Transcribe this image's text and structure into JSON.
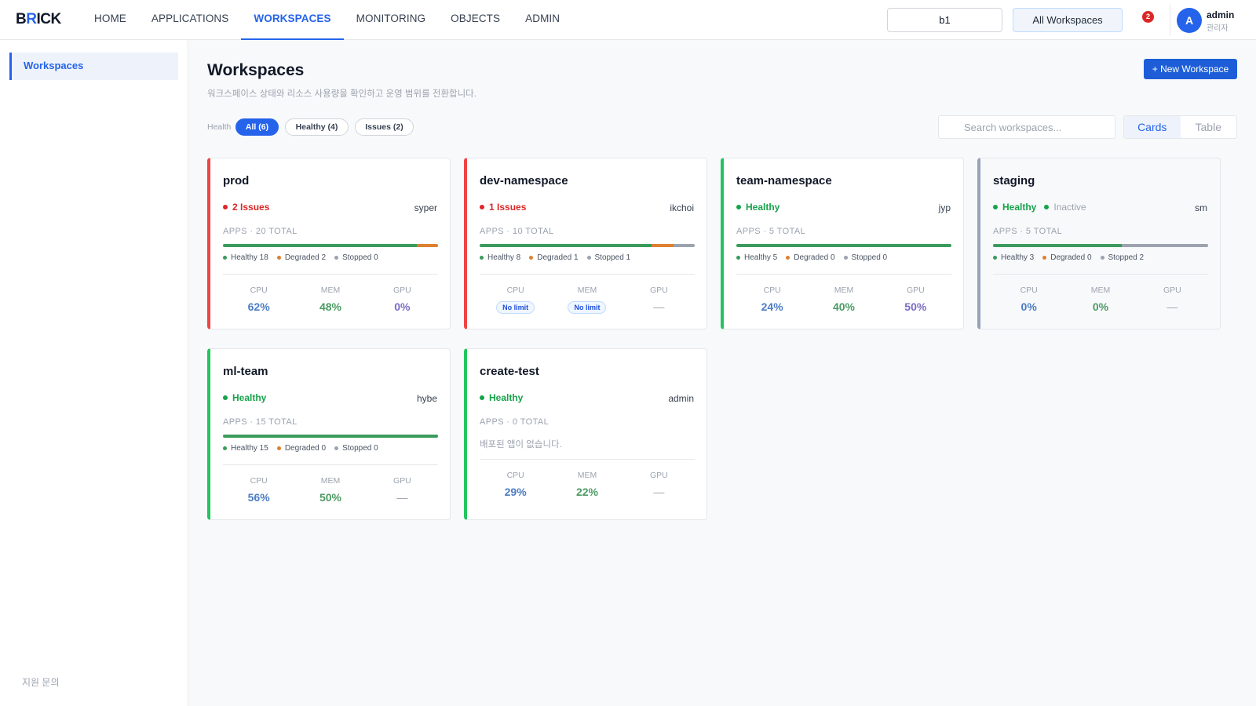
{
  "app": {
    "logo_b": "B",
    "logo_r": "R",
    "logo_rest": "ICK"
  },
  "nav": {
    "items": [
      "HOME",
      "APPLICATIONS",
      "WORKSPACES",
      "MONITORING",
      "OBJECTS",
      "ADMIN"
    ],
    "active": "WORKSPACES"
  },
  "header": {
    "namespace_value": "b1",
    "workspace_scope": "All Workspaces",
    "notification_count": "2",
    "user": {
      "initial": "A",
      "name": "admin",
      "role": "관리자"
    }
  },
  "sidebar": {
    "items": [
      {
        "label": "Workspaces"
      }
    ],
    "support_label": "지원 문의"
  },
  "page": {
    "title": "Workspaces",
    "subtitle": "워크스페이스 상태와 리소스 사용량을 확인하고 운영 범위를 전환합니다.",
    "new_button": "+ New Workspace",
    "filter_label": "Health",
    "filters": [
      "All (6)",
      "Healthy (4)",
      "Issues (2)"
    ],
    "active_filter": "All (6)",
    "search_placeholder": "Search workspaces...",
    "view_options": [
      "Cards",
      "Table"
    ],
    "active_view": "Cards"
  },
  "workspaces": [
    {
      "name": "prod",
      "status": "2 Issues",
      "state": "issue",
      "inactive": "",
      "owner": "syper",
      "apps_label": "APPS · 20 TOTAL",
      "total": 20,
      "healthy": 18,
      "degraded": 2,
      "stopped": 0,
      "legend_healthy": "Healthy 18",
      "legend_degraded": "Degraded 2",
      "legend_stopped": "Stopped 0",
      "empty_text": "",
      "cpu": "62%",
      "mem": "48%",
      "gpu": "0%"
    },
    {
      "name": "dev-namespace",
      "status": "1 Issues",
      "state": "issue",
      "inactive": "",
      "owner": "ikchoi",
      "apps_label": "APPS · 10 TOTAL",
      "total": 10,
      "healthy": 8,
      "degraded": 1,
      "stopped": 1,
      "legend_healthy": "Healthy 8",
      "legend_degraded": "Degraded 1",
      "legend_stopped": "Stopped 1",
      "empty_text": "",
      "cpu": "No limit",
      "mem": "No limit",
      "gpu": "—"
    },
    {
      "name": "team-namespace",
      "status": "Healthy",
      "state": "ok",
      "inactive": "",
      "owner": "jyp",
      "apps_label": "APPS · 5 TOTAL",
      "total": 5,
      "healthy": 5,
      "degraded": 0,
      "stopped": 0,
      "legend_healthy": "Healthy 5",
      "legend_degraded": "Degraded 0",
      "legend_stopped": "Stopped 0",
      "empty_text": "",
      "cpu": "24%",
      "mem": "40%",
      "gpu": "50%"
    },
    {
      "name": "staging",
      "status": "Healthy",
      "state": "ok",
      "inactive": "Inactive",
      "owner": "sm",
      "apps_label": "APPS · 5 TOTAL",
      "total": 5,
      "healthy": 3,
      "degraded": 0,
      "stopped": 2,
      "legend_healthy": "Healthy 3",
      "legend_degraded": "Degraded 0",
      "legend_stopped": "Stopped 2",
      "empty_text": "",
      "cpu": "0%",
      "mem": "0%",
      "gpu": "—"
    },
    {
      "name": "ml-team",
      "status": "Healthy",
      "state": "ok",
      "inactive": "",
      "owner": "hybe",
      "apps_label": "APPS · 15 TOTAL",
      "total": 15,
      "healthy": 15,
      "degraded": 0,
      "stopped": 0,
      "legend_healthy": "Healthy 15",
      "legend_degraded": "Degraded 0",
      "legend_stopped": "Stopped 0",
      "empty_text": "",
      "cpu": "56%",
      "mem": "50%",
      "gpu": "—"
    },
    {
      "name": "create-test",
      "status": "Healthy",
      "state": "ok",
      "inactive": "",
      "owner": "admin",
      "apps_label": "APPS · 0 TOTAL",
      "total": 0,
      "healthy": 0,
      "degraded": 0,
      "stopped": 0,
      "legend_healthy": "",
      "legend_degraded": "",
      "legend_stopped": "",
      "empty_text": "배포된 앱이 없습니다.",
      "cpu": "29%",
      "mem": "22%",
      "gpu": "—"
    }
  ],
  "metric_labels": {
    "cpu": "CPU",
    "mem": "MEM",
    "gpu": "GPU"
  },
  "icons": {
    "search": "search-icon",
    "bell": "notification-badge"
  },
  "colors": {
    "accent": "#2563eb",
    "healthy": "#16a34a",
    "issue": "#dc2626",
    "degraded": "#dd8030",
    "stopped": "#9ca3af"
  }
}
